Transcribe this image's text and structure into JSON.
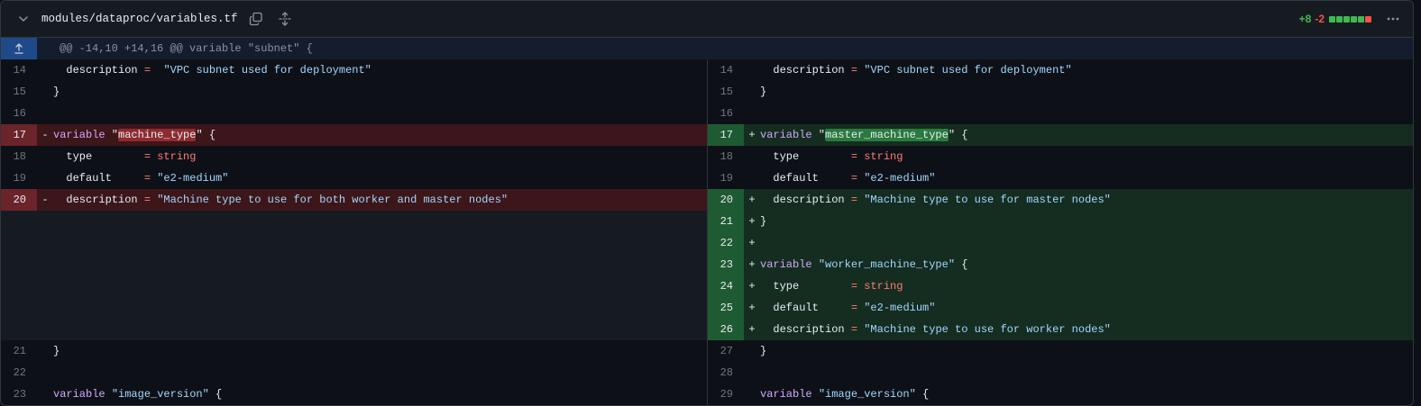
{
  "file": {
    "path": "modules/dataproc/variables.tf",
    "additions": "+8",
    "deletions": "-2",
    "diffstat_blocks": [
      "add",
      "add",
      "add",
      "add",
      "add",
      "del"
    ]
  },
  "icons": {
    "collapse": "chevron-down-icon",
    "copy": "copy-icon",
    "expand_all": "unfold-icon",
    "more": "kebab-horizontal-icon",
    "hunk_expand": "fold-up-icon"
  },
  "colors": {
    "addition": "#3fb950",
    "deletion": "#f85149",
    "keyword": "#d2a8ff",
    "string": "#a5d6ff",
    "operator": "#ff7b72"
  },
  "hunk": {
    "header": "@@ -14,10 +14,16 @@ variable \"subnet\" {"
  },
  "left": [
    {
      "n": "14",
      "t": "ctx",
      "m": "",
      "c": [
        [
          "",
          "  description "
        ],
        [
          "op",
          "="
        ],
        [
          "",
          "  "
        ],
        [
          "str",
          "\"VPC subnet used for deployment\""
        ]
      ]
    },
    {
      "n": "15",
      "t": "ctx",
      "m": "",
      "c": [
        [
          "",
          "}"
        ]
      ]
    },
    {
      "n": "16",
      "t": "ctx",
      "m": "",
      "c": []
    },
    {
      "n": "17",
      "t": "del",
      "m": "-",
      "c": [
        [
          "kw",
          "variable"
        ],
        [
          "",
          " \""
        ],
        [
          "hl-del",
          "machine_type"
        ],
        [
          "",
          "\" {"
        ]
      ]
    },
    {
      "n": "18",
      "t": "ctx",
      "m": "",
      "c": [
        [
          "",
          "  type        "
        ],
        [
          "op",
          "="
        ],
        [
          "",
          " "
        ],
        [
          "op",
          "string"
        ]
      ]
    },
    {
      "n": "19",
      "t": "ctx",
      "m": "",
      "c": [
        [
          "",
          "  default     "
        ],
        [
          "op",
          "="
        ],
        [
          "",
          " "
        ],
        [
          "str",
          "\"e2-medium\""
        ]
      ]
    },
    {
      "n": "20",
      "t": "del",
      "m": "-",
      "c": [
        [
          "",
          "  description "
        ],
        [
          "op",
          "="
        ],
        [
          "",
          " "
        ],
        [
          "str",
          "\"Machine type to use for both worker and master nodes\""
        ]
      ]
    },
    {
      "n": "",
      "t": "empty",
      "m": "",
      "c": []
    },
    {
      "n": "",
      "t": "empty",
      "m": "",
      "c": []
    },
    {
      "n": "",
      "t": "empty",
      "m": "",
      "c": []
    },
    {
      "n": "",
      "t": "empty",
      "m": "",
      "c": []
    },
    {
      "n": "",
      "t": "empty",
      "m": "",
      "c": []
    },
    {
      "n": "",
      "t": "empty",
      "m": "",
      "c": []
    },
    {
      "n": "21",
      "t": "ctx",
      "m": "",
      "c": [
        [
          "",
          "}"
        ]
      ]
    },
    {
      "n": "22",
      "t": "ctx",
      "m": "",
      "c": []
    },
    {
      "n": "23",
      "t": "ctx",
      "m": "",
      "c": [
        [
          "kw",
          "variable"
        ],
        [
          "",
          " "
        ],
        [
          "str",
          "\"image_version\""
        ],
        [
          "",
          " {"
        ]
      ]
    }
  ],
  "right": [
    {
      "n": "14",
      "t": "ctx",
      "m": "",
      "c": [
        [
          "",
          "  description "
        ],
        [
          "op",
          "="
        ],
        [
          "",
          " "
        ],
        [
          "str",
          "\"VPC subnet used for deployment\""
        ]
      ]
    },
    {
      "n": "15",
      "t": "ctx",
      "m": "",
      "c": [
        [
          "",
          "}"
        ]
      ]
    },
    {
      "n": "16",
      "t": "ctx",
      "m": "",
      "c": []
    },
    {
      "n": "17",
      "t": "add",
      "m": "+",
      "c": [
        [
          "kw",
          "variable"
        ],
        [
          "",
          " \""
        ],
        [
          "hl-add",
          "master_machine_type"
        ],
        [
          "",
          "\" {"
        ]
      ]
    },
    {
      "n": "18",
      "t": "ctx",
      "m": "",
      "c": [
        [
          "",
          "  type        "
        ],
        [
          "op",
          "="
        ],
        [
          "",
          " "
        ],
        [
          "op",
          "string"
        ]
      ]
    },
    {
      "n": "19",
      "t": "ctx",
      "m": "",
      "c": [
        [
          "",
          "  default     "
        ],
        [
          "op",
          "="
        ],
        [
          "",
          " "
        ],
        [
          "str",
          "\"e2-medium\""
        ]
      ]
    },
    {
      "n": "20",
      "t": "add",
      "m": "+",
      "c": [
        [
          "",
          "  description "
        ],
        [
          "op",
          "="
        ],
        [
          "",
          " "
        ],
        [
          "str",
          "\"Machine type to use for master nodes\""
        ]
      ]
    },
    {
      "n": "21",
      "t": "add",
      "m": "+",
      "c": [
        [
          "",
          "}"
        ]
      ]
    },
    {
      "n": "22",
      "t": "add",
      "m": "+",
      "c": []
    },
    {
      "n": "23",
      "t": "add",
      "m": "+",
      "c": [
        [
          "kw",
          "variable"
        ],
        [
          "",
          " "
        ],
        [
          "str",
          "\"worker_machine_type\""
        ],
        [
          "",
          " {"
        ]
      ]
    },
    {
      "n": "24",
      "t": "add",
      "m": "+",
      "c": [
        [
          "",
          "  type        "
        ],
        [
          "op",
          "="
        ],
        [
          "",
          " "
        ],
        [
          "op",
          "string"
        ]
      ]
    },
    {
      "n": "25",
      "t": "add",
      "m": "+",
      "c": [
        [
          "",
          "  default     "
        ],
        [
          "op",
          "="
        ],
        [
          "",
          " "
        ],
        [
          "str",
          "\"e2-medium\""
        ]
      ]
    },
    {
      "n": "26",
      "t": "add",
      "m": "+",
      "c": [
        [
          "",
          "  description "
        ],
        [
          "op",
          "="
        ],
        [
          "",
          " "
        ],
        [
          "str",
          "\"Machine type to use for worker nodes\""
        ]
      ]
    },
    {
      "n": "27",
      "t": "ctx",
      "m": "",
      "c": [
        [
          "",
          "}"
        ]
      ]
    },
    {
      "n": "28",
      "t": "ctx",
      "m": "",
      "c": []
    },
    {
      "n": "29",
      "t": "ctx",
      "m": "",
      "c": [
        [
          "kw",
          "variable"
        ],
        [
          "",
          " "
        ],
        [
          "str",
          "\"image_version\""
        ],
        [
          "",
          " {"
        ]
      ]
    }
  ]
}
